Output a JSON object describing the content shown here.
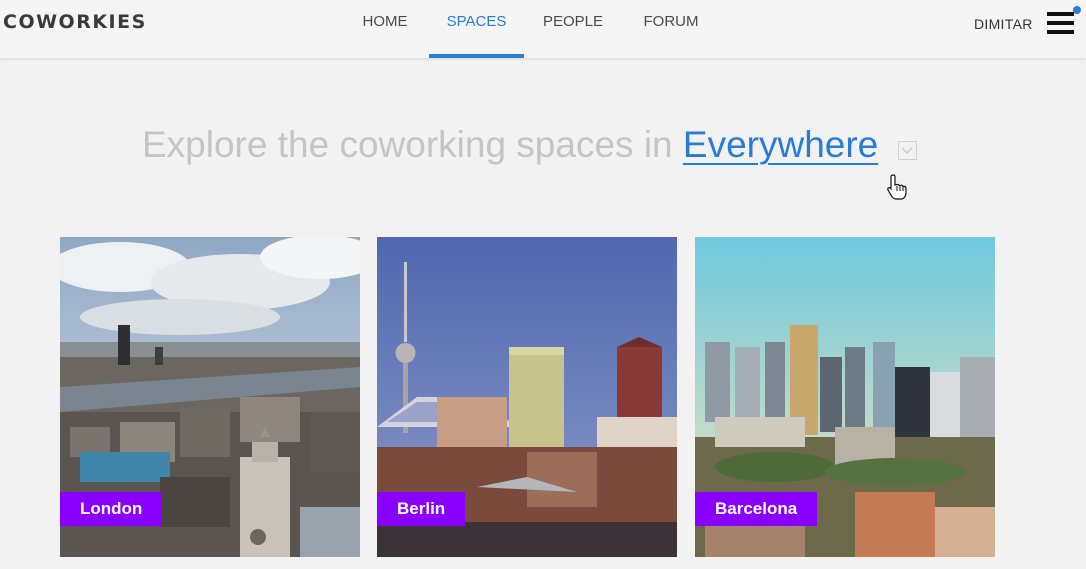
{
  "header": {
    "logo": "COWORKIES",
    "nav": [
      {
        "label": "HOME",
        "active": false
      },
      {
        "label": "SPACES",
        "active": true
      },
      {
        "label": "PEOPLE",
        "active": false
      },
      {
        "label": "FORUM",
        "active": false
      }
    ],
    "username": "DIMITAR",
    "accent_color": "#2a7bd4"
  },
  "hero": {
    "prefix": "Explore the coworking spaces in ",
    "location": "Everywhere"
  },
  "cards": [
    {
      "city": "London"
    },
    {
      "city": "Berlin"
    },
    {
      "city": "Barcelona"
    }
  ],
  "label_color": "#8a00ff"
}
